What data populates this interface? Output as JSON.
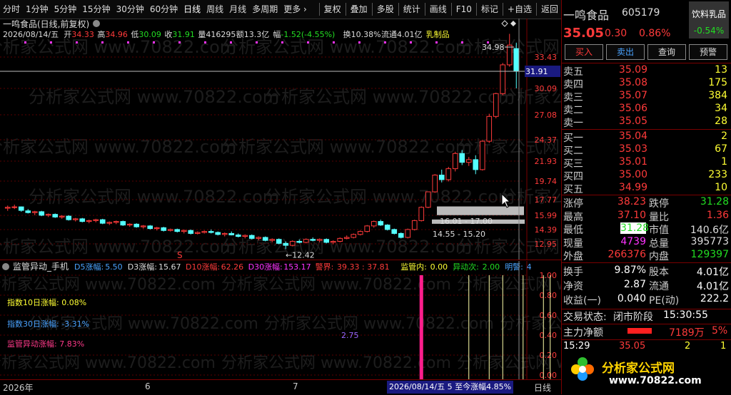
{
  "toolbar": {
    "items": [
      "分时",
      "1分钟",
      "5分钟",
      "15分钟",
      "30分钟",
      "60分钟",
      "日线",
      "周线",
      "月线",
      "多周期",
      "更多 ›"
    ],
    "right": [
      "复权",
      "叠加",
      "多股",
      "统计",
      "画线",
      "F10",
      "标记",
      "+自选",
      "返回"
    ]
  },
  "chart": {
    "title": "一鸣食品(日线,前复权)",
    "info": {
      "date": "2026/08/14/五",
      "open_label": "开",
      "open": "34.33",
      "high_label": "高",
      "high": "34.96",
      "low_label": "低",
      "low": "30.09",
      "close_label": "收",
      "close": "31.91",
      "vol_label": "量",
      "vol": "416295",
      "amt_label": "额",
      "amt": "13.3亿",
      "chg_label": "幅",
      "chg": "-1.52(-4.55%)",
      "turn_label": "换",
      "turn": "10.38%",
      "float_label": "流通",
      "float": "4.01亿",
      "sector": "乳制品"
    },
    "price_axis": [
      "33.43",
      "30.09",
      "27.08",
      "24.37",
      "21.93",
      "19.74",
      "17.77",
      "15.99",
      "14.39",
      "12.95"
    ],
    "current_price": "31.91",
    "annotations": {
      "high": "34.98",
      "low": "12.42",
      "zone1": "16.01 - 17.00",
      "zone2": "14.55 - 15.20",
      "s_mark": "S"
    },
    "watermark": "分析家公式网 www.70822.com",
    "candles": [
      [
        16.8,
        17.1,
        16.5,
        16.9
      ],
      [
        16.9,
        17.2,
        16.7,
        16.95
      ],
      [
        16.95,
        17.0,
        16.4,
        16.55
      ],
      [
        16.5,
        16.7,
        16.2,
        16.3
      ],
      [
        16.3,
        16.5,
        16.0,
        16.4
      ],
      [
        16.4,
        16.5,
        15.9,
        16.0
      ],
      [
        16.0,
        16.2,
        15.8,
        16.1
      ],
      [
        16.1,
        16.2,
        15.7,
        15.8
      ],
      [
        15.8,
        16.0,
        15.6,
        15.9
      ],
      [
        15.9,
        16.0,
        15.4,
        15.5
      ],
      [
        15.5,
        15.7,
        15.3,
        15.6
      ],
      [
        15.6,
        15.7,
        15.2,
        15.3
      ],
      [
        15.3,
        15.5,
        15.1,
        15.4
      ],
      [
        15.4,
        15.6,
        15.2,
        15.5
      ],
      [
        15.5,
        15.6,
        15.0,
        15.1
      ],
      [
        15.1,
        15.3,
        14.9,
        15.2
      ],
      [
        15.2,
        15.4,
        15.0,
        15.3
      ],
      [
        15.3,
        15.4,
        14.8,
        14.9
      ],
      [
        14.9,
        15.1,
        14.7,
        15.0
      ],
      [
        15.0,
        15.1,
        14.6,
        14.7
      ],
      [
        14.7,
        14.9,
        14.5,
        14.8
      ],
      [
        14.8,
        14.9,
        14.4,
        14.5
      ],
      [
        14.5,
        14.7,
        14.3,
        14.6
      ],
      [
        14.6,
        14.7,
        14.2,
        14.3
      ],
      [
        14.3,
        14.5,
        14.2,
        14.4
      ],
      [
        14.4,
        14.5,
        14.1,
        14.2
      ],
      [
        14.2,
        14.4,
        14.0,
        14.3
      ],
      [
        14.3,
        14.4,
        13.9,
        14.0
      ],
      [
        14.0,
        14.2,
        13.9,
        14.1
      ],
      [
        14.1,
        14.3,
        14.0,
        14.2
      ],
      [
        14.2,
        14.4,
        14.0,
        14.1
      ],
      [
        14.1,
        14.2,
        13.8,
        13.9
      ],
      [
        13.9,
        14.1,
        13.7,
        14.0
      ],
      [
        14.0,
        14.2,
        13.8,
        13.85
      ],
      [
        13.85,
        14.0,
        13.6,
        13.7
      ],
      [
        13.7,
        13.9,
        13.5,
        13.8
      ],
      [
        13.8,
        13.9,
        13.4,
        13.5
      ],
      [
        13.5,
        13.7,
        13.3,
        13.6
      ],
      [
        13.6,
        13.7,
        13.2,
        13.3
      ],
      [
        13.3,
        13.5,
        13.1,
        13.4
      ],
      [
        13.4,
        13.5,
        12.9,
        13.0
      ],
      [
        13.0,
        13.2,
        12.42,
        12.8
      ],
      [
        12.8,
        13.3,
        12.7,
        13.2
      ],
      [
        13.2,
        13.4,
        13.0,
        13.1
      ],
      [
        13.1,
        13.5,
        13.0,
        13.4
      ],
      [
        13.4,
        13.6,
        13.2,
        13.3
      ],
      [
        13.3,
        13.5,
        13.1,
        13.4
      ],
      [
        13.4,
        13.5,
        13.0,
        13.1
      ],
      [
        13.1,
        13.3,
        12.9,
        13.2
      ],
      [
        13.2,
        13.6,
        13.1,
        13.5
      ],
      [
        13.5,
        13.8,
        13.4,
        13.6
      ],
      [
        13.6,
        14.0,
        13.5,
        13.9
      ],
      [
        13.9,
        14.3,
        13.8,
        14.2
      ],
      [
        14.2,
        14.9,
        14.1,
        14.8
      ],
      [
        14.8,
        15.4,
        14.6,
        15.3
      ],
      [
        15.3,
        15.5,
        14.8,
        14.9
      ],
      [
        14.9,
        15.0,
        14.3,
        14.4
      ],
      [
        14.4,
        14.5,
        13.9,
        14.0
      ],
      [
        14.0,
        14.1,
        13.5,
        13.6
      ],
      [
        13.6,
        14.5,
        13.5,
        14.4
      ],
      [
        14.4,
        15.5,
        14.3,
        15.4
      ],
      [
        15.4,
        17.0,
        15.3,
        16.9
      ],
      [
        16.9,
        18.6,
        16.8,
        18.6
      ],
      [
        18.6,
        20.5,
        18.5,
        20.4
      ],
      [
        20.4,
        21.0,
        19.6,
        19.9
      ],
      [
        19.9,
        21.3,
        19.7,
        21.1
      ],
      [
        21.1,
        23.0,
        20.8,
        22.8
      ],
      [
        22.8,
        23.2,
        21.5,
        21.8
      ],
      [
        21.8,
        22.4,
        21.4,
        22.1
      ],
      [
        22.1,
        22.6,
        20.5,
        21.0
      ],
      [
        21.0,
        24.3,
        20.9,
        24.2
      ],
      [
        24.2,
        27.2,
        24.0,
        26.9
      ],
      [
        26.9,
        29.6,
        26.7,
        29.5
      ],
      [
        29.5,
        32.8,
        29.3,
        32.6
      ],
      [
        32.6,
        35.9,
        32.4,
        34.7
      ],
      [
        34.33,
        34.96,
        30.09,
        31.91
      ]
    ]
  },
  "indicator": {
    "title": "监管异动_手机",
    "params": [
      {
        "label": "D5涨幅:",
        "value": "5.50",
        "color": "#4aa3ff"
      },
      {
        "label": "D3涨幅:",
        "value": "15.67",
        "color": "#dddddd"
      },
      {
        "label": "D10涨幅:",
        "value": "62.26",
        "color": "#ff3a3a"
      },
      {
        "label": "D30涨幅:",
        "value": "153.17",
        "color": "#ff33ff"
      },
      {
        "label": "警界:",
        "value": "39.33 : 37.81",
        "color": "#ff3a3a"
      },
      {
        "label": "监管内:",
        "value": "0.00",
        "color": "#ffff33"
      },
      {
        "label": "异动次:",
        "value": "2.00",
        "color": "#22dd22"
      },
      {
        "label": "明警:",
        "value": "4",
        "color": "#4aa3ff"
      }
    ],
    "axis": [
      "1.00",
      "0.80",
      "0.60",
      "0.40",
      "0.20",
      "0.00"
    ],
    "text1": "指数10日涨幅: 0.08%",
    "text2": "指数30日涨幅: -3.31%",
    "text3": "监管异动涨幅: 7.83%",
    "bar_label": "2.75",
    "bars": [
      {
        "pos": 61,
        "color": "#ff1e8c",
        "wide": true
      },
      {
        "pos": 68,
        "color": "#ffffaa",
        "wide": false
      },
      {
        "pos": 71,
        "color": "#ffffaa",
        "wide": false
      },
      {
        "pos": 73,
        "color": "#ffffaa",
        "wide": false
      },
      {
        "pos": 76,
        "color": "#ffffaa",
        "wide": false
      },
      {
        "pos": 79,
        "color": "#ffffaa",
        "wide": false
      },
      {
        "pos": 80,
        "color": "#ffffaa",
        "wide": false
      },
      {
        "pos": 87,
        "color": "#1b6bcf",
        "wide": true
      },
      {
        "pos": 92,
        "color": "#ffffaa",
        "wide": false
      },
      {
        "pos": 94,
        "color": "#ffffaa",
        "wide": false
      }
    ]
  },
  "datebar": {
    "labels": [
      "2026年",
      "6",
      "7"
    ],
    "range": "2026/08/14/五 5 至今涨幅4.85%",
    "period": "日线"
  },
  "quote": {
    "name": "一鸣食品",
    "code": "605179",
    "industry": "饮料乳品",
    "price": "35.05",
    "change": "0.30",
    "pct": "0.86%",
    "ind_pct": "-0.54%",
    "buttons": [
      "买入",
      "卖出",
      "查询",
      "预警"
    ],
    "sells": [
      {
        "label": "卖五",
        "price": "35.09",
        "vol": "13"
      },
      {
        "label": "卖四",
        "price": "35.08",
        "vol": "175"
      },
      {
        "label": "卖三",
        "price": "35.07",
        "vol": "384"
      },
      {
        "label": "卖二",
        "price": "35.06",
        "vol": "34"
      },
      {
        "label": "卖一",
        "price": "35.05",
        "vol": "28"
      }
    ],
    "buys": [
      {
        "label": "买一",
        "price": "35.04",
        "vol": "2"
      },
      {
        "label": "买二",
        "price": "35.03",
        "vol": "67"
      },
      {
        "label": "买三",
        "price": "35.01",
        "vol": "1"
      },
      {
        "label": "买四",
        "price": "35.00",
        "vol": "233"
      },
      {
        "label": "买五",
        "price": "34.99",
        "vol": "10"
      }
    ],
    "stats": [
      {
        "l1": "涨停",
        "v1": "38.23",
        "c1": "#ff3a3a",
        "l2": "跌停",
        "v2": "31.28",
        "c2": "#22dd22"
      },
      {
        "l1": "最高",
        "v1": "37.10",
        "c1": "#ff3a3a",
        "l2": "量比",
        "v2": "1.36",
        "c2": "#ff3a3a"
      },
      {
        "l1": "最低",
        "v1": "31.28",
        "c1": "#22dd22",
        "l2": "市值",
        "v2": "140.6亿",
        "c2": "#dddddd"
      },
      {
        "l1": "现量",
        "v1": "4739",
        "c1": "#ff33ff",
        "l2": "总量",
        "v2": "395773",
        "c2": "#dddddd"
      },
      {
        "l1": "外盘",
        "v1": "266376",
        "c1": "#ff3a3a",
        "l2": "内盘",
        "v2": "129397",
        "c2": "#22dd22"
      }
    ],
    "stats2": [
      {
        "l1": "换手",
        "v1": "9.87%",
        "l2": "股本",
        "v2": "4.01亿"
      },
      {
        "l1": "净资",
        "v1": "2.87",
        "l2": "流通",
        "v2": "4.01亿"
      },
      {
        "l1": "收益(一)",
        "v1": "0.040",
        "l2": "PE(动)",
        "v2": "222.2"
      }
    ],
    "status_label": "交易状态:",
    "status": "闭市阶段",
    "status_time": "15:30:55",
    "main_label": "主力净额",
    "main_value": "7189万",
    "main_pct": "5%",
    "tick_time": "15:29",
    "tick_price": "35.05",
    "tick_vol": "2",
    "tick_n": "1",
    "logo": "分析家公式网",
    "logo_url": "www.70822.com"
  }
}
